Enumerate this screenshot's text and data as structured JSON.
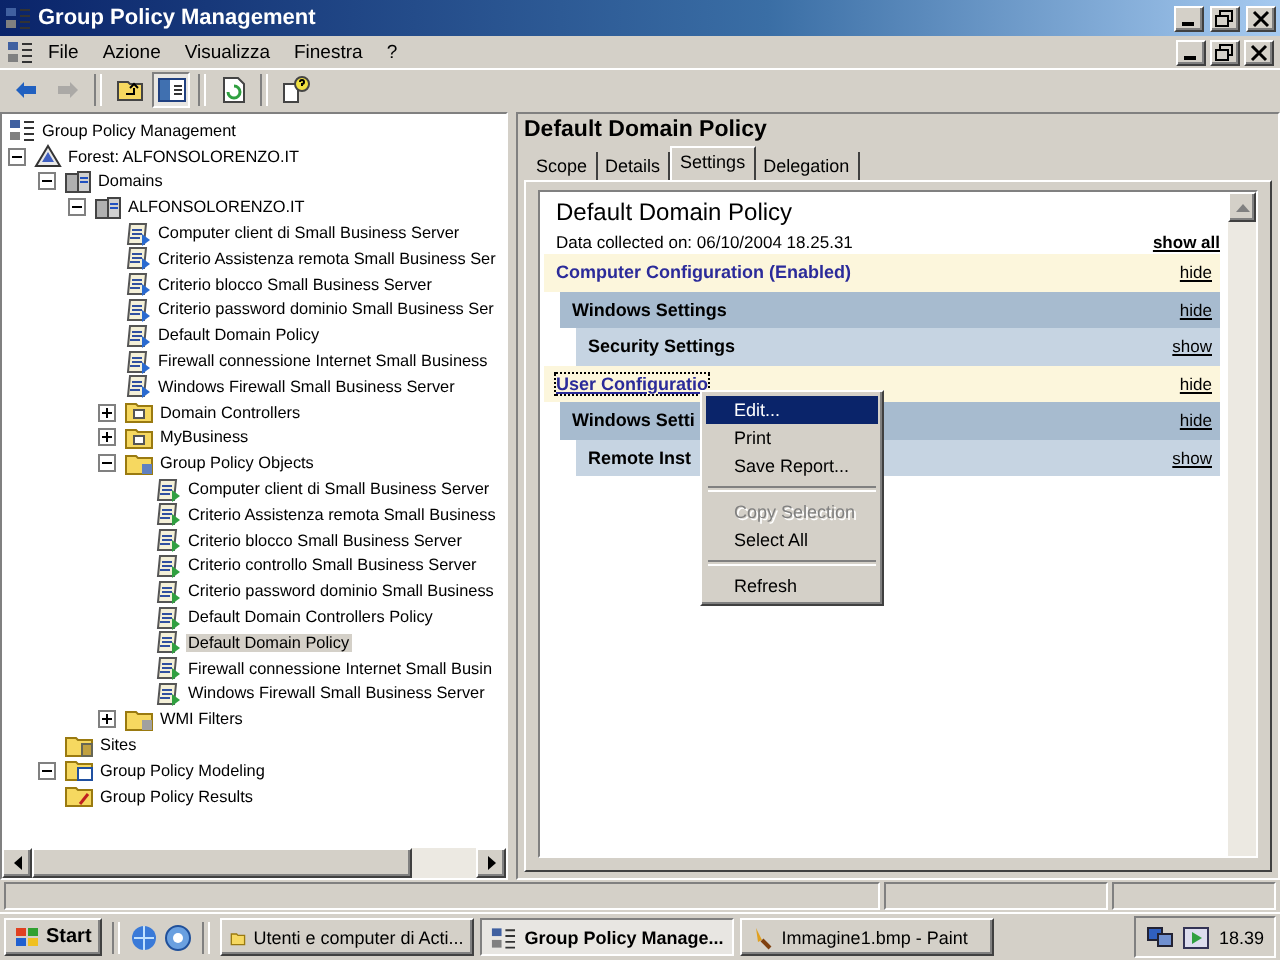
{
  "window": {
    "title": "Group Policy Management"
  },
  "menu": [
    {
      "label": "File"
    },
    {
      "label": "Azione"
    },
    {
      "label": "Visualizza"
    },
    {
      "label": "Finestra"
    },
    {
      "label": "?"
    }
  ],
  "toolbar": [
    {
      "kind": "back",
      "disabled": false,
      "pressed": false
    },
    {
      "kind": "forward",
      "disabled": true,
      "pressed": false
    },
    {
      "kind": "up",
      "disabled": false,
      "pressed": false
    },
    {
      "kind": "tree",
      "disabled": false,
      "pressed": true
    },
    {
      "kind": "refresh",
      "disabled": false,
      "pressed": false
    },
    {
      "kind": "help",
      "disabled": false,
      "pressed": false
    }
  ],
  "tree": [
    {
      "label": "Group Policy Management",
      "kind": "console",
      "selected": false,
      "children": [
        {
          "label": "Forest: ALFONSOLORENZO.IT",
          "kind": "forest",
          "selected": false,
          "expanded": true,
          "children": [
            {
              "label": "Domains",
              "kind": "domains",
              "selected": false,
              "expanded": true,
              "children": [
                {
                  "label": "ALFONSOLORENZO.IT",
                  "kind": "domain",
                  "selected": false,
                  "expanded": true,
                  "children": [
                    {
                      "label": "Computer client di Small Business Server",
                      "kind": "link",
                      "selected": false
                    },
                    {
                      "label": "Criterio Assistenza remota Small Business Ser",
                      "kind": "link",
                      "selected": false
                    },
                    {
                      "label": "Criterio blocco Small Business Server",
                      "kind": "link",
                      "selected": false
                    },
                    {
                      "label": "Criterio password dominio Small Business Ser",
                      "kind": "link",
                      "selected": false
                    },
                    {
                      "label": "Default Domain Policy",
                      "kind": "link",
                      "selected": false
                    },
                    {
                      "label": "Firewall connessione Internet Small Business",
                      "kind": "link",
                      "selected": false
                    },
                    {
                      "label": "Windows Firewall Small Business Server",
                      "kind": "link",
                      "selected": false
                    },
                    {
                      "label": "Domain Controllers",
                      "kind": "ou",
                      "selected": false,
                      "expanded": false
                    },
                    {
                      "label": "MyBusiness",
                      "kind": "ou",
                      "selected": false,
                      "expanded": false
                    },
                    {
                      "label": "Group Policy Objects",
                      "kind": "folder",
                      "selected": false,
                      "expanded": true,
                      "children": [
                        {
                          "label": "Computer client di Small Business Server",
                          "kind": "gpo",
                          "selected": false
                        },
                        {
                          "label": "Criterio Assistenza remota Small Business",
                          "kind": "gpo",
                          "selected": false
                        },
                        {
                          "label": "Criterio blocco Small Business Server",
                          "kind": "gpo",
                          "selected": false
                        },
                        {
                          "label": "Criterio controllo Small Business Server",
                          "kind": "gpo",
                          "selected": false
                        },
                        {
                          "label": "Criterio password dominio Small Business",
                          "kind": "gpo",
                          "selected": false
                        },
                        {
                          "label": "Default Domain Controllers Policy",
                          "kind": "gpo",
                          "selected": false
                        },
                        {
                          "label": "Default Domain Policy",
                          "kind": "gpo",
                          "selected": true
                        },
                        {
                          "label": "Firewall connessione Internet Small Busin",
                          "kind": "gpo",
                          "selected": false
                        },
                        {
                          "label": "Windows Firewall Small Business Server",
                          "kind": "gpo",
                          "selected": false
                        }
                      ]
                    },
                    {
                      "label": "WMI Filters",
                      "kind": "wmi",
                      "selected": false,
                      "expanded": false
                    }
                  ]
                }
              ]
            },
            {
              "label": "Sites",
              "kind": "sites",
              "selected": false
            },
            {
              "label": "Group Policy Modeling",
              "kind": "modeling",
              "selected": false,
              "expanded": true
            },
            {
              "label": "Group Policy Results",
              "kind": "results",
              "selected": false
            }
          ]
        }
      ]
    }
  ],
  "details": {
    "title": "Default Domain Policy",
    "tabs": [
      {
        "label": "Scope",
        "selected": false
      },
      {
        "label": "Details",
        "selected": false
      },
      {
        "label": "Settings",
        "selected": true
      },
      {
        "label": "Delegation",
        "selected": false
      }
    ],
    "report": {
      "title": "Default Domain Policy",
      "collected": "Data collected on: 06/10/2004 18.25.31",
      "show_all": "show all",
      "sections": [
        {
          "kind": "config",
          "label": "Computer Configuration (Enabled)",
          "action": "hide",
          "focused": false
        },
        {
          "kind": "group",
          "label": "Windows Settings",
          "action": "hide",
          "focused": false
        },
        {
          "kind": "subgroup",
          "label": "Security Settings",
          "action": "show",
          "focused": false
        },
        {
          "kind": "config",
          "label": "User Configuratio",
          "action": "hide",
          "focused": true
        },
        {
          "kind": "group",
          "label": "Windows Setti",
          "action": "hide",
          "focused": false
        },
        {
          "kind": "subgroup",
          "label": "Remote Inst",
          "action": "show",
          "focused": false
        }
      ]
    }
  },
  "context_menu": [
    {
      "kind": "item",
      "label": "Edit...",
      "selected": true,
      "disabled": false
    },
    {
      "kind": "item",
      "label": "Print",
      "selected": false,
      "disabled": false
    },
    {
      "kind": "item",
      "label": "Save Report...",
      "selected": false,
      "disabled": false
    },
    {
      "kind": "separator"
    },
    {
      "kind": "item",
      "label": "Copy Selection",
      "selected": false,
      "disabled": true
    },
    {
      "kind": "item",
      "label": "Select All",
      "selected": false,
      "disabled": false
    },
    {
      "kind": "separator"
    },
    {
      "kind": "item",
      "label": "Refresh",
      "selected": false,
      "disabled": false
    }
  ],
  "taskbar": {
    "start": "Start",
    "tasks": [
      {
        "label": "Utenti e computer di Acti...",
        "kind": "folder",
        "selected": false
      },
      {
        "label": "Group Policy Manage...",
        "kind": "console",
        "selected": true
      },
      {
        "label": "Immagine1.bmp - Paint",
        "kind": "paint",
        "selected": false
      }
    ],
    "clock": "18.39"
  }
}
